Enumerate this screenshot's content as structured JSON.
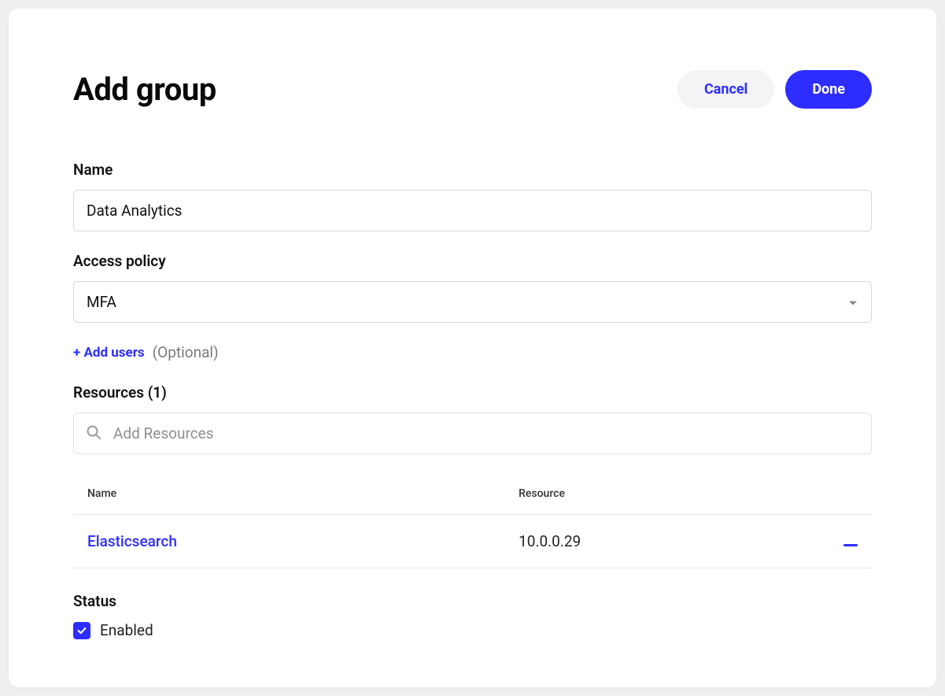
{
  "header": {
    "title": "Add group",
    "cancel_label": "Cancel",
    "done_label": "Done"
  },
  "form": {
    "name_label": "Name",
    "name_value": "Data Analytics",
    "access_policy_label": "Access policy",
    "access_policy_value": "MFA",
    "add_users_label": "+ Add users",
    "add_users_optional": "(Optional)"
  },
  "resources": {
    "heading": "Resources (1)",
    "search_placeholder": "Add Resources",
    "columns": {
      "name": "Name",
      "resource": "Resource"
    },
    "items": [
      {
        "name": "Elasticsearch",
        "resource": "10.0.0.29"
      }
    ]
  },
  "status": {
    "label": "Status",
    "enabled_label": "Enabled",
    "enabled_checked": true
  },
  "colors": {
    "primary": "#2d2dff"
  }
}
